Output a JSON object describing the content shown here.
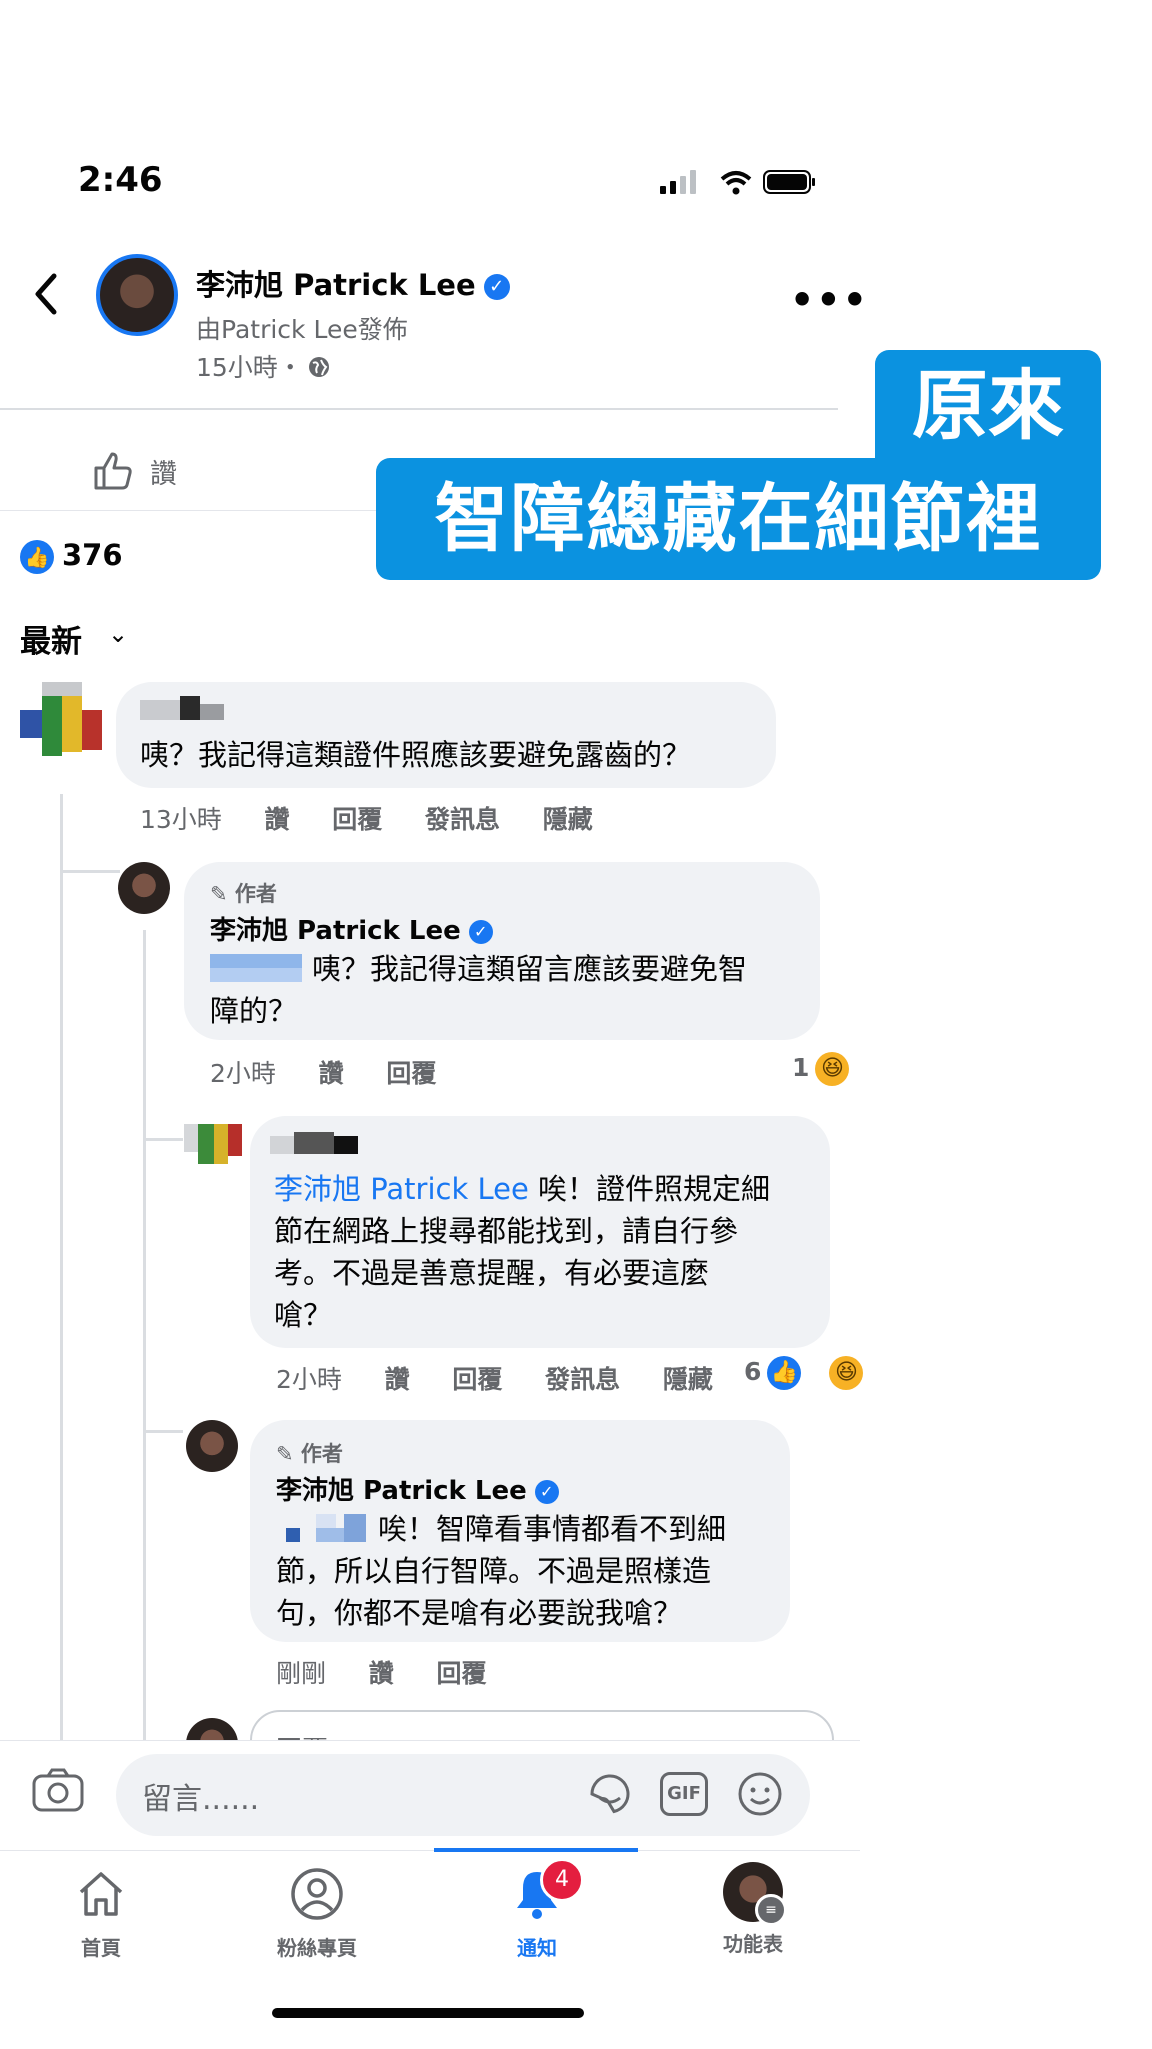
{
  "status": {
    "time": "2:46"
  },
  "post": {
    "page_name": "李沛旭 Patrick Lee",
    "published_by": "由Patrick Lee發佈",
    "time": "15小時・",
    "like_label": "讚",
    "reaction_count": "376",
    "sort_label": "最新"
  },
  "caption": {
    "line1": "原來",
    "line2": "智障總藏在細節裡"
  },
  "comments": [
    {
      "text": "咦？我記得這類證件照應該要避免露齒的？",
      "time": "13小時",
      "like": "讚",
      "reply": "回覆",
      "message": "發訊息",
      "hide": "隱藏"
    },
    {
      "author_tag": "作者",
      "name": "李沛旭 Patrick Lee",
      "text_line1": "咦？我記得這類留言應該要避免智",
      "text_line2": "障的？",
      "time": "2小時",
      "like": "讚",
      "reply": "回覆",
      "reactions": "1"
    },
    {
      "mention": "李沛旭 Patrick Lee",
      "text_line1": " 唉！證件照規定細",
      "text_line2": "節在網路上搜尋都能找到，請自行參",
      "text_line3": "考。不過是善意提醒，有必要這麼",
      "text_line4": "嗆？",
      "time": "2小時",
      "like": "讚",
      "reply": "回覆",
      "message": "發訊息",
      "hide": "隱藏",
      "reactions": "6"
    },
    {
      "author_tag": "作者",
      "name": "李沛旭 Patrick Lee",
      "text_line1": "唉！智障看事情都看不到細",
      "text_line2": "節，所以自行智障。不過是照樣造",
      "text_line3": "句，你都不是嗆有必要說我嗆？",
      "time": "剛剛",
      "like": "讚",
      "reply": "回覆"
    }
  ],
  "reply_box": {
    "placeholder": "回覆"
  },
  "composer": {
    "placeholder": "留言......",
    "gif_label": "GIF"
  },
  "nav": {
    "home": "首頁",
    "pages": "粉絲專頁",
    "notifications": "通知",
    "notification_badge": "4",
    "menu": "功能表"
  },
  "colors": {
    "accent": "#1877f2",
    "caption_bg": "#0b92e0",
    "badge": "#e41e3f"
  }
}
